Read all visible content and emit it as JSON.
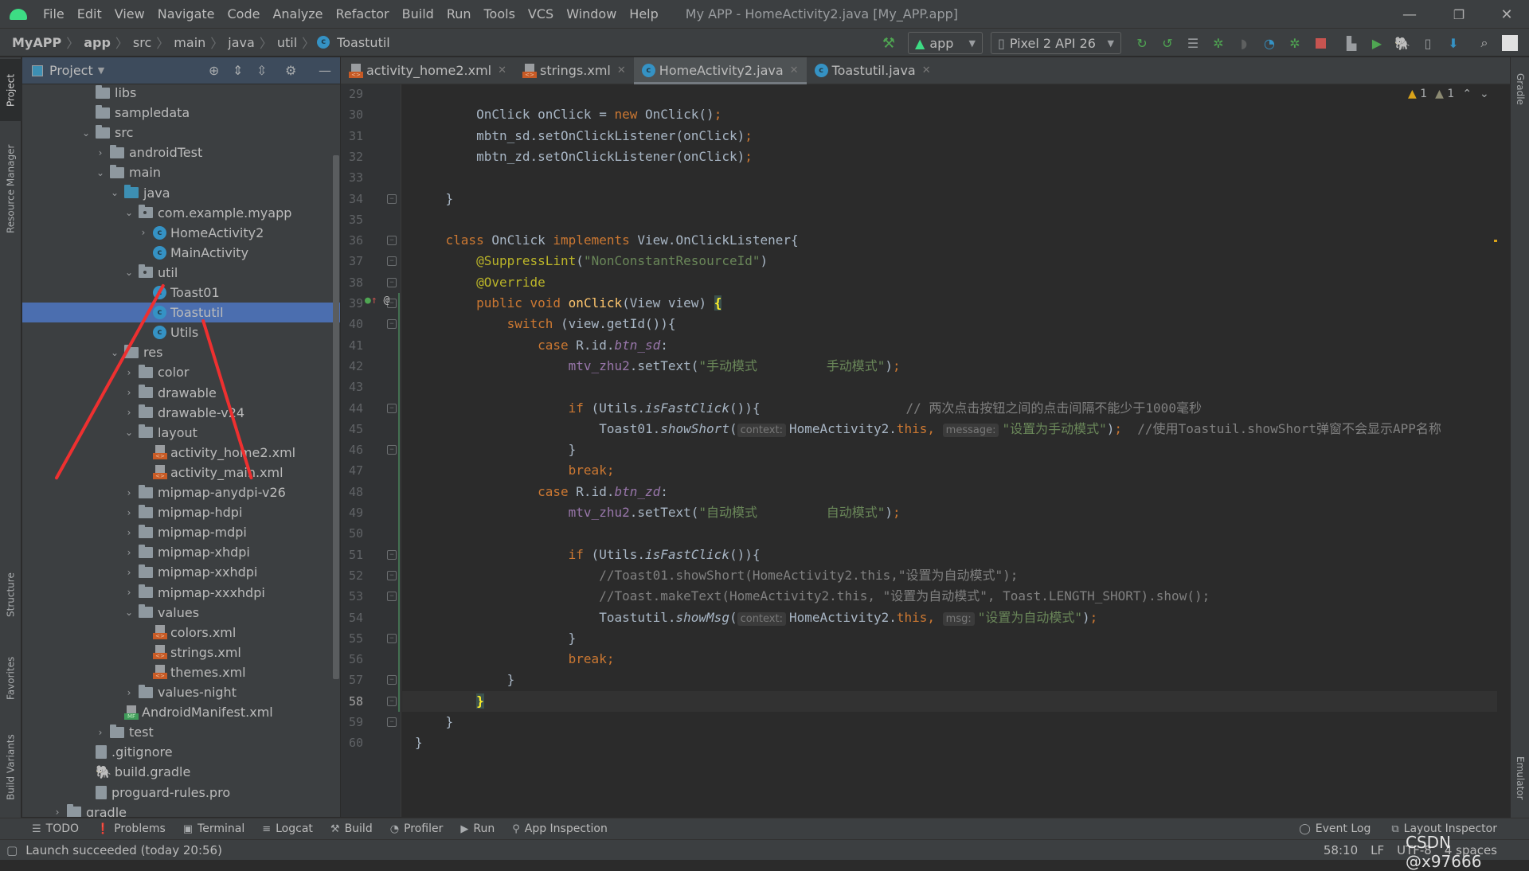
{
  "window": {
    "title": "My APP - HomeActivity2.java [My_APP.app]",
    "menu": [
      "File",
      "Edit",
      "View",
      "Navigate",
      "Code",
      "Analyze",
      "Refactor",
      "Build",
      "Run",
      "Tools",
      "VCS",
      "Window",
      "Help"
    ],
    "controls": {
      "minimize": "—",
      "restore": "❐",
      "close": "✕"
    }
  },
  "breadcrumb": [
    "MyAPP",
    "app",
    "src",
    "main",
    "java",
    "util",
    "Toastutil"
  ],
  "toolbar": {
    "run_config": "app",
    "device": "Pixel 2 API 26",
    "icons": [
      "hammer-icon",
      "apply-changes-restart-icon",
      "apply-code-changes-icon",
      "sync-icon",
      "debug-icon",
      "coverage-icon",
      "profile-icon",
      "attach-debugger-icon",
      "stop-icon",
      "project-structure-icon",
      "avd-manager-icon",
      "gradle-sync-icon",
      "device-manager-icon",
      "sdk-manager-icon",
      "search-icon",
      "account-icon"
    ]
  },
  "left_strip": [
    "Project",
    "Resource Manager",
    "Structure",
    "Favorites",
    "Build Variants"
  ],
  "right_strip": [
    "Gradle",
    "Emulator"
  ],
  "project_panel": {
    "title": "Project",
    "tree": [
      {
        "label": "libs",
        "type": "folder",
        "depth": 3,
        "arrow": ""
      },
      {
        "label": "sampledata",
        "type": "folder",
        "depth": 3,
        "arrow": ""
      },
      {
        "label": "src",
        "type": "folder",
        "depth": 3,
        "arrow": "open"
      },
      {
        "label": "androidTest",
        "type": "folder",
        "depth": 4,
        "arrow": "closed"
      },
      {
        "label": "main",
        "type": "folder",
        "depth": 4,
        "arrow": "open"
      },
      {
        "label": "java",
        "type": "src",
        "depth": 5,
        "arrow": "open"
      },
      {
        "label": "com.example.myapp",
        "type": "pkg",
        "depth": 6,
        "arrow": "open"
      },
      {
        "label": "HomeActivity2",
        "type": "class",
        "depth": 7,
        "arrow": "closed"
      },
      {
        "label": "MainActivity",
        "type": "class",
        "depth": 7,
        "arrow": ""
      },
      {
        "label": "util",
        "type": "pkg",
        "depth": 6,
        "arrow": "open"
      },
      {
        "label": "Toast01",
        "type": "class",
        "depth": 7,
        "arrow": ""
      },
      {
        "label": "Toastutil",
        "type": "class",
        "depth": 7,
        "arrow": "",
        "selected": true
      },
      {
        "label": "Utils",
        "type": "class",
        "depth": 7,
        "arrow": ""
      },
      {
        "label": "res",
        "type": "res",
        "depth": 5,
        "arrow": "open"
      },
      {
        "label": "color",
        "type": "folder",
        "depth": 6,
        "arrow": "closed"
      },
      {
        "label": "drawable",
        "type": "folder",
        "depth": 6,
        "arrow": "closed"
      },
      {
        "label": "drawable-v24",
        "type": "folder",
        "depth": 6,
        "arrow": "closed"
      },
      {
        "label": "layout",
        "type": "folder",
        "depth": 6,
        "arrow": "open"
      },
      {
        "label": "activity_home2.xml",
        "type": "xml",
        "depth": 7,
        "arrow": ""
      },
      {
        "label": "activity_main.xml",
        "type": "xml",
        "depth": 7,
        "arrow": ""
      },
      {
        "label": "mipmap-anydpi-v26",
        "type": "folder",
        "depth": 6,
        "arrow": "closed"
      },
      {
        "label": "mipmap-hdpi",
        "type": "folder",
        "depth": 6,
        "arrow": "closed"
      },
      {
        "label": "mipmap-mdpi",
        "type": "folder",
        "depth": 6,
        "arrow": "closed"
      },
      {
        "label": "mipmap-xhdpi",
        "type": "folder",
        "depth": 6,
        "arrow": "closed"
      },
      {
        "label": "mipmap-xxhdpi",
        "type": "folder",
        "depth": 6,
        "arrow": "closed"
      },
      {
        "label": "mipmap-xxxhdpi",
        "type": "folder",
        "depth": 6,
        "arrow": "closed"
      },
      {
        "label": "values",
        "type": "folder",
        "depth": 6,
        "arrow": "open"
      },
      {
        "label": "colors.xml",
        "type": "xml",
        "depth": 7,
        "arrow": ""
      },
      {
        "label": "strings.xml",
        "type": "xml",
        "depth": 7,
        "arrow": ""
      },
      {
        "label": "themes.xml",
        "type": "xml",
        "depth": 7,
        "arrow": ""
      },
      {
        "label": "values-night",
        "type": "folder",
        "depth": 6,
        "arrow": "closed"
      },
      {
        "label": "AndroidManifest.xml",
        "type": "manifest",
        "depth": 5,
        "arrow": ""
      },
      {
        "label": "test",
        "type": "folder",
        "depth": 4,
        "arrow": "closed"
      },
      {
        "label": ".gitignore",
        "type": "file",
        "depth": 3,
        "arrow": ""
      },
      {
        "label": "build.gradle",
        "type": "gradle",
        "depth": 3,
        "arrow": ""
      },
      {
        "label": "proguard-rules.pro",
        "type": "file",
        "depth": 3,
        "arrow": ""
      },
      {
        "label": "gradle",
        "type": "folder",
        "depth": 1,
        "arrow": "closed"
      }
    ]
  },
  "editor_tabs": [
    {
      "label": "activity_home2.xml",
      "icon": "xml",
      "active": false
    },
    {
      "label": "strings.xml",
      "icon": "xml",
      "active": false
    },
    {
      "label": "HomeActivity2.java",
      "icon": "class",
      "active": true
    },
    {
      "label": "Toastutil.java",
      "icon": "class",
      "active": false
    }
  ],
  "inspections": {
    "warnings": "1",
    "weak_warnings": "1"
  },
  "code": {
    "current_line": 58,
    "lines": [
      {
        "n": 29,
        "html": ""
      },
      {
        "n": 30,
        "html": "        OnClick onClick = <span class='k'>new</span> OnClick()<span class='k'>;</span>"
      },
      {
        "n": 31,
        "html": "        mbtn_sd.setOnClickListener(onClick)<span class='k'>;</span>"
      },
      {
        "n": 32,
        "html": "        mbtn_zd.setOnClickListener(onClick)<span class='k'>;</span>"
      },
      {
        "n": 33,
        "html": ""
      },
      {
        "n": 34,
        "html": "    }"
      },
      {
        "n": 35,
        "html": ""
      },
      {
        "n": 36,
        "html": "    <span class='k'>class</span> OnClick <span class='k'>implements</span> View.OnClickListener{"
      },
      {
        "n": 37,
        "html": "        <span class='a'>@SuppressLint</span>(<span class='s'>\"NonConstantResourceId\"</span>)"
      },
      {
        "n": 38,
        "html": "        <span class='a'>@Override</span>"
      },
      {
        "n": 39,
        "html": "        <span class='k'>public void</span> <span class='f'>onClick</span>(View view) <span class='bm'>{</span>"
      },
      {
        "n": 40,
        "html": "            <span class='k'>switch</span> (view.getId()){"
      },
      {
        "n": 41,
        "html": "                <span class='k'>case</span> R.id.<span class='v it'>btn_sd</span>:"
      },
      {
        "n": 42,
        "html": "                    <span class='v'>mtv_zhu2</span>.setText(<span class='s'>\"手动模式         手动模式\"</span>)<span class='k'>;</span>"
      },
      {
        "n": 43,
        "html": ""
      },
      {
        "n": 44,
        "html": "                    <span class='k'>if</span> (Utils.<span class='it'>isFastClick</span>()){                   <span class='c'>// 两次点击按钮之间的点击间隔不能少于1000毫秒</span>"
      },
      {
        "n": 45,
        "html": "                        Toast01.<span class='it'>showShort</span>(<span class='hint'>context:</span>HomeActivity2.<span class='k'>this,</span> <span class='hint'>message:</span><span class='s'>\"设置为手动模式\"</span>)<span class='k'>;</span>  <span class='c'>//使用Toastuil.showShort弹窗不会显示APP名称</span>"
      },
      {
        "n": 46,
        "html": "                    }"
      },
      {
        "n": 47,
        "html": "                    <span class='k'>break;</span>"
      },
      {
        "n": 48,
        "html": "                <span class='k'>case</span> R.id.<span class='v it'>btn_zd</span>:"
      },
      {
        "n": 49,
        "html": "                    <span class='v'>mtv_zhu2</span>.setText(<span class='s'>\"自动模式         自动模式\"</span>)<span class='k'>;</span>"
      },
      {
        "n": 50,
        "html": ""
      },
      {
        "n": 51,
        "html": "                    <span class='k'>if</span> (Utils.<span class='it'>isFastClick</span>()){"
      },
      {
        "n": 52,
        "html": "                        <span class='c'>//Toast01.showShort(HomeActivity2.this,\"设置为自动模式\");</span>"
      },
      {
        "n": 53,
        "html": "                        <span class='c'>//Toast.makeText(HomeActivity2.this, \"设置为自动模式\", Toast.LENGTH_SHORT).show();</span>"
      },
      {
        "n": 54,
        "html": "                        Toastutil.<span class='it'>showMsg</span>(<span class='hint'>context:</span>HomeActivity2.<span class='k'>this,</span> <span class='hint'>msg:</span><span class='s'>\"设置为自动模式\"</span>)<span class='k'>;</span>"
      },
      {
        "n": 55,
        "html": "                    }"
      },
      {
        "n": 56,
        "html": "                    <span class='k'>break;</span>"
      },
      {
        "n": 57,
        "html": "            }"
      },
      {
        "n": 58,
        "html": "        <span class='bm'>}</span>"
      },
      {
        "n": 59,
        "html": "    }"
      },
      {
        "n": 60,
        "html": "}"
      }
    ]
  },
  "bottom_tools": [
    {
      "label": "TODO",
      "icon": "list-icon",
      "glyph": "☰"
    },
    {
      "label": "Problems",
      "icon": "problems-icon",
      "glyph": "❗"
    },
    {
      "label": "Terminal",
      "icon": "terminal-icon",
      "glyph": "▣"
    },
    {
      "label": "Logcat",
      "icon": "logcat-icon",
      "glyph": "≡"
    },
    {
      "label": "Build",
      "icon": "hammer-icon",
      "glyph": "⚒"
    },
    {
      "label": "Profiler",
      "icon": "profiler-icon",
      "glyph": "◔"
    },
    {
      "label": "Run",
      "icon": "run-icon",
      "glyph": "▶"
    },
    {
      "label": "App Inspection",
      "icon": "app-inspection-icon",
      "glyph": "⚲"
    }
  ],
  "bottom_tools_right": [
    {
      "label": "Event Log",
      "icon": "event-log-icon",
      "glyph": "◯"
    },
    {
      "label": "Layout Inspector",
      "icon": "layout-inspector-icon",
      "glyph": "⧉"
    }
  ],
  "status": {
    "message": "Launch succeeded (today 20:56)",
    "position": "58:10",
    "line_sep": "LF",
    "encoding": "UTF-8",
    "indent": "4 spaces",
    "watermark": "CSDN @x97666"
  }
}
